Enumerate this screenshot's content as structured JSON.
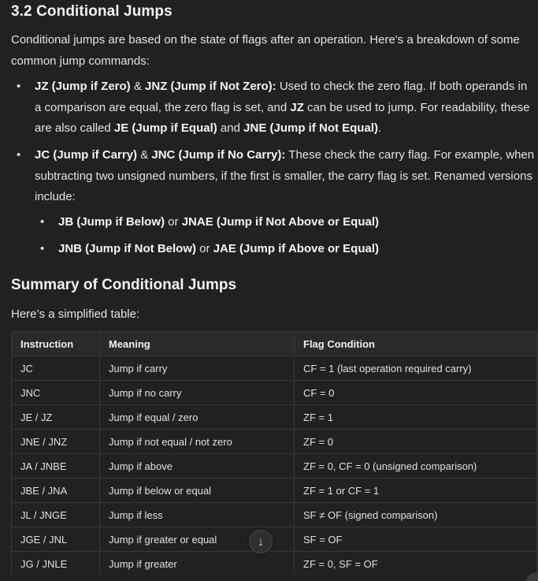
{
  "section_heading": "3.2 Conditional Jumps",
  "intro": "Conditional jumps are based on the state of flags after an operation. Here's a breakdown of some common jump commands:",
  "bullets": [
    {
      "strong1": "JZ (Jump if Zero)",
      "amp": " & ",
      "strong2": "JNZ (Jump if Not Zero):",
      "text1": " Used to check the zero flag. If both operands in a comparison are equal, the zero flag is set, and ",
      "strong3": "JZ",
      "text2": " can be used to jump. For readability, these are also called ",
      "strong4": "JE (Jump if Equal)",
      "text3": " and ",
      "strong5": "JNE (Jump if Not Equal)",
      "text4": "."
    },
    {
      "strong1": "JC (Jump if Carry)",
      "amp": " & ",
      "strong2": "JNC (Jump if No Carry):",
      "text1": " These check the carry flag. For example, when subtracting two unsigned numbers, if the first is smaller, the carry flag is set. Renamed versions include:"
    }
  ],
  "sub_bullets": [
    {
      "strong1": "JB (Jump if Below)",
      "or": " or ",
      "strong2": "JNAE (Jump if Not Above or Equal)"
    },
    {
      "strong1": "JNB (Jump if Not Below)",
      "or": " or ",
      "strong2": "JAE (Jump if Above or Equal)"
    }
  ],
  "bullet_glyph": "•",
  "summary_heading": "Summary of Conditional Jumps",
  "table_intro": "Here’s a simplified table:",
  "table": {
    "headers": [
      "Instruction",
      "Meaning",
      "Flag Condition"
    ],
    "rows": [
      [
        "JC",
        "Jump if carry",
        "CF = 1 (last operation required carry)"
      ],
      [
        "JNC",
        "Jump if no carry",
        "CF = 0"
      ],
      [
        "JE / JZ",
        "Jump if equal / zero",
        "ZF = 1"
      ],
      [
        "JNE / JNZ",
        "Jump if not equal / not zero",
        "ZF = 0"
      ],
      [
        "JA / JNBE",
        "Jump if above",
        "ZF = 0, CF = 0 (unsigned comparison)"
      ],
      [
        "JBE / JNA",
        "Jump if below or equal",
        "ZF = 1 or CF = 1"
      ],
      [
        "JL / JNGE",
        "Jump if less",
        "SF ≠ OF (signed comparison)"
      ],
      [
        "JGE / JNL",
        "Jump if greater or equal",
        "SF = OF"
      ],
      [
        "JG / JNLE",
        "Jump if greater",
        "ZF = 0, SF = OF"
      ]
    ]
  },
  "scroll_button": {
    "icon": "arrow-down-icon",
    "glyph": "↓"
  },
  "colors": {
    "background": "#212121",
    "text": "#e3e3e3",
    "border": "#3a3a3a",
    "header_bg": "#2a2a2a"
  }
}
